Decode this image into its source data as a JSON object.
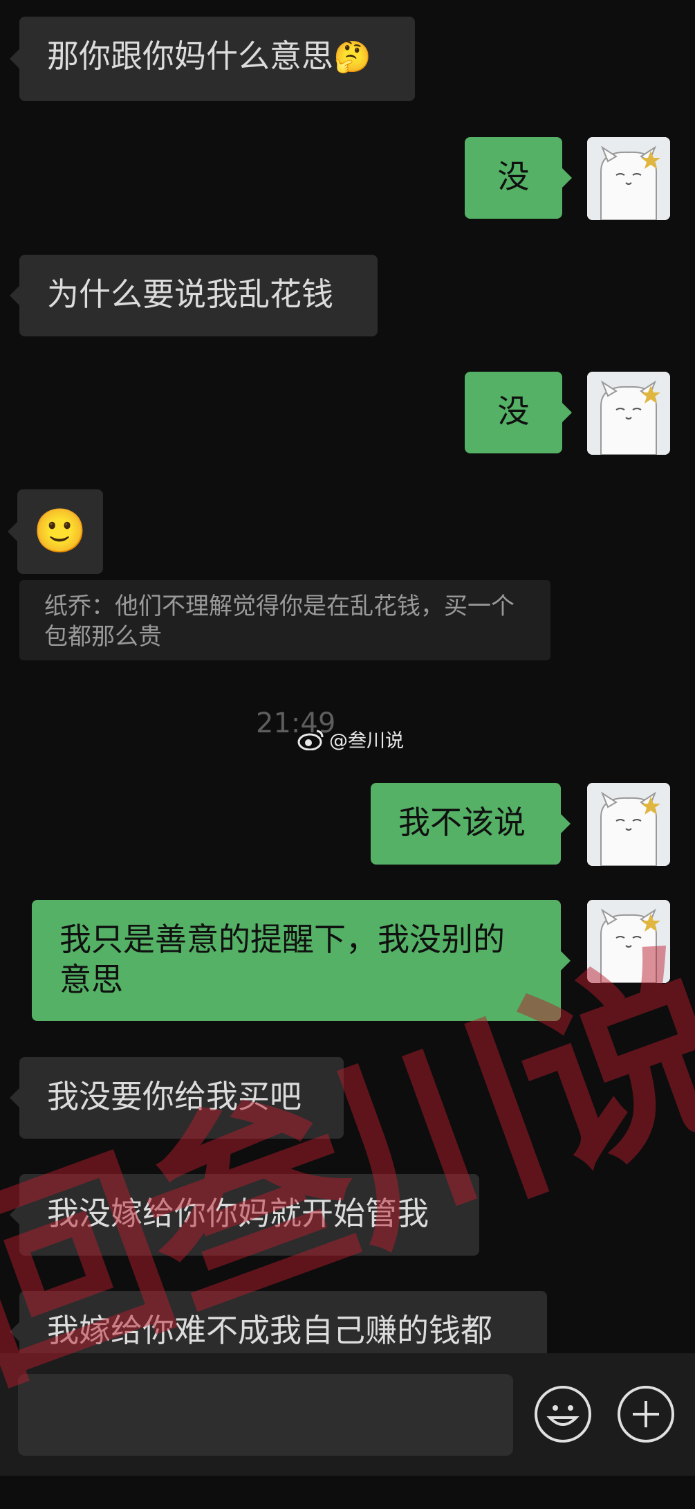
{
  "messages": [
    {
      "side": "in",
      "text": "那你跟你妈什么意思",
      "emoji": "🤔"
    },
    {
      "side": "out",
      "text": "没"
    },
    {
      "side": "in",
      "text": "为什么要说我乱花钱"
    },
    {
      "side": "out",
      "text": "没"
    },
    {
      "side": "in",
      "emoji": "🙂"
    },
    {
      "side": "quote",
      "text": "纸乔：他们不理解觉得你是在乱花钱，买一个包都那么贵"
    },
    {
      "side": "time",
      "text": "21:49"
    },
    {
      "side": "out",
      "text": "我不该说"
    },
    {
      "side": "out",
      "text": "我只是善意的提醒下，我没别的意思"
    },
    {
      "side": "in",
      "text": "我没要你给我买吧"
    },
    {
      "side": "in",
      "text": "我没嫁给你你妈就开始管我"
    },
    {
      "side": "in",
      "text": "我嫁给你难不成我自己赚的钱都"
    }
  ],
  "watermark": {
    "small": "@叁川说",
    "large": "回叁川说"
  },
  "input_bar": {
    "emoji_icon": "smiley-face-icon",
    "more_icon": "plus-icon"
  }
}
